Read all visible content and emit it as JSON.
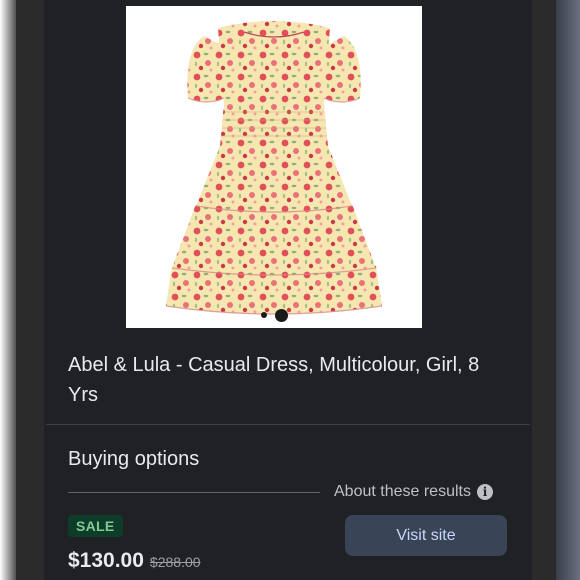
{
  "product": {
    "title": "Abel & Lula - Casual Dress, Multicolour, Girl, 8 Yrs",
    "image_icon": "floral-dress-image",
    "carousel_count": 2,
    "carousel_active": 2
  },
  "buying": {
    "heading": "Buying options",
    "about_label": "About these results",
    "info_icon": "i",
    "badge": "SALE",
    "price": "$130.00",
    "original_price": "$288.00",
    "visit_label": "Visit site"
  },
  "colors": {
    "background": "#202124",
    "sale_badge_bg": "#0d3d28",
    "sale_badge_text": "#81c995",
    "visit_button_bg": "#394457"
  }
}
